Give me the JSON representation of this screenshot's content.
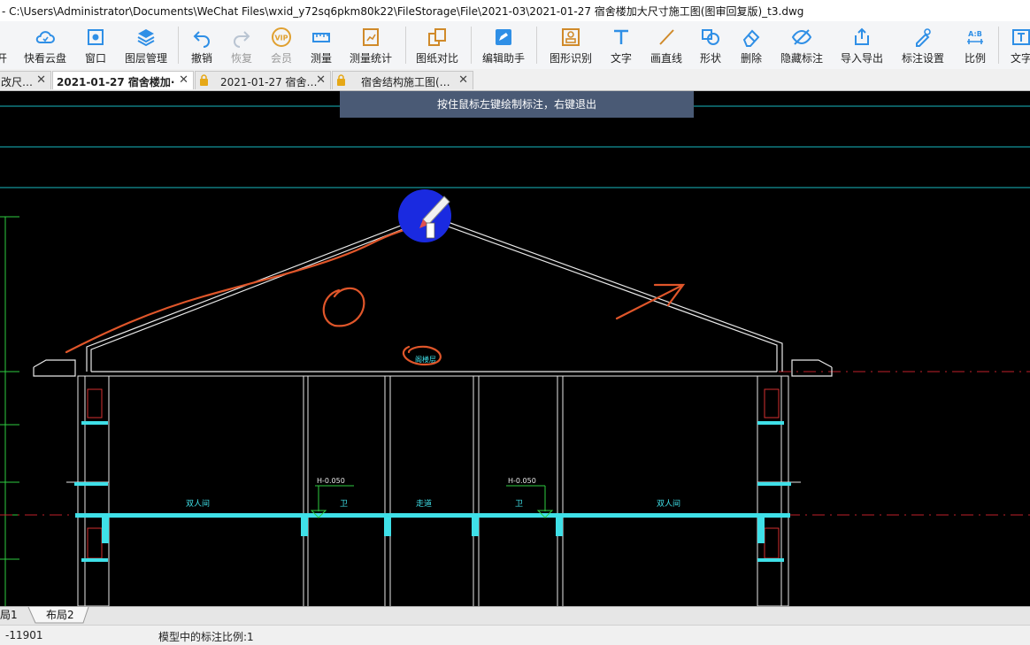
{
  "title": "- C:\\Users\\Administrator\\Documents\\WeChat Files\\wxid_y72sq6pkm80k22\\FileStorage\\File\\2021-03\\2021-01-27 宿舍楼加大尺寸施工图(图审回复版)_t3.dwg",
  "toolbar": {
    "partial_left": "开",
    "cloud": "快看云盘",
    "window": "窗口",
    "layers": "图层管理",
    "undo": "撤销",
    "redo": "恢复",
    "vip": "会员",
    "vip_badge": "VIP",
    "measure": "测量",
    "measure_stats": "测量统计",
    "compare": "图纸对比",
    "edit_helper": "编辑助手",
    "shape_recog": "图形识别",
    "text": "文字",
    "line": "画直线",
    "shape": "形状",
    "delete": "删除",
    "hide_annot": "隐藏标注",
    "import_export": "导入导出",
    "annot_settings": "标注设置",
    "scale": "比例",
    "scale_icon": "A:B",
    "text2": "文字"
  },
  "tabs": [
    {
      "label": "改尺…",
      "close": "✕"
    },
    {
      "label": "2021-01-27 宿舍楼加·",
      "close": "✕"
    },
    {
      "label": "2021-01-27 宿舍…",
      "close": "✕"
    },
    {
      "label": "宿舍结构施工图(…",
      "close": "✕"
    }
  ],
  "tooltip": "按住鼠标左键绘制标注，右键退出",
  "drawing": {
    "attic_label": "阁楼层",
    "room_left": "双人间",
    "bath_left": "卫",
    "corridor": "走道",
    "bath_right": "卫",
    "room_right": "双人间",
    "elev_left": "H-0.050",
    "elev_right": "H-0.050"
  },
  "layout_tabs": [
    "局1",
    "布局2"
  ],
  "status": {
    "coord": "-11901",
    "scale_text": "模型中的标注比例:1"
  },
  "colors": {
    "canvas": "#000000",
    "cyan": "#00e5e5",
    "annotation": "#e0562a",
    "cursor_blue": "#1a2ae0",
    "tooltip_bg": "#4a5a75"
  }
}
